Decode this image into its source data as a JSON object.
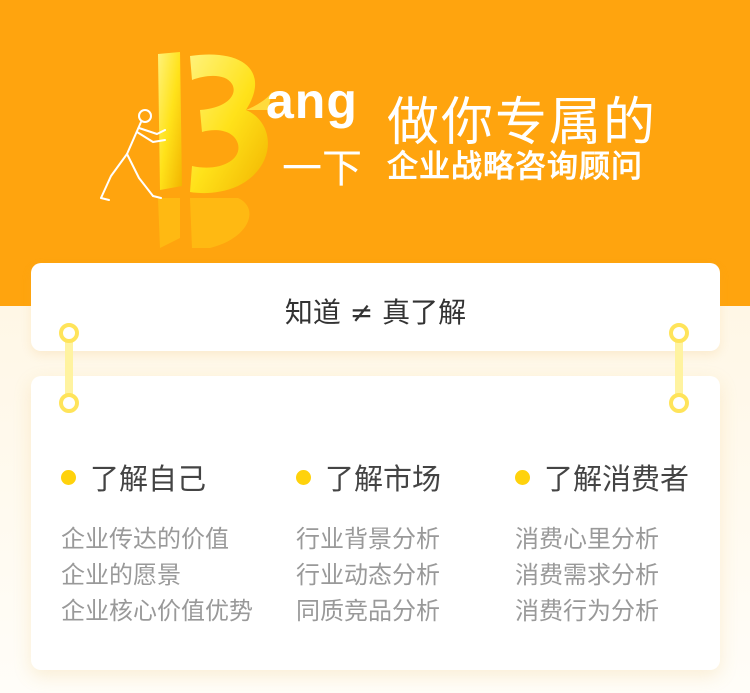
{
  "hero": {
    "ang": "ang",
    "yixia": "一下",
    "title_line1": "做你专属的",
    "title_line2": "企业战略咨询顾问"
  },
  "card_top": {
    "title": "知道 ≠ 真了解"
  },
  "columns": [
    {
      "heading": "了解自己",
      "items": [
        "企业传达的价值",
        "企业的愿景",
        "企业核心价值优势"
      ]
    },
    {
      "heading": "了解市场",
      "items": [
        "行业背景分析",
        "行业动态分析",
        "同质竞品分析"
      ]
    },
    {
      "heading": "了解消费者",
      "items": [
        "消费心里分析",
        "消费需求分析",
        "消费行为分析"
      ]
    }
  ],
  "colors": {
    "hero_orange": "#ffa40e",
    "bullet_yellow": "#ffd20c",
    "ring_yellow": "#ffe45a"
  }
}
